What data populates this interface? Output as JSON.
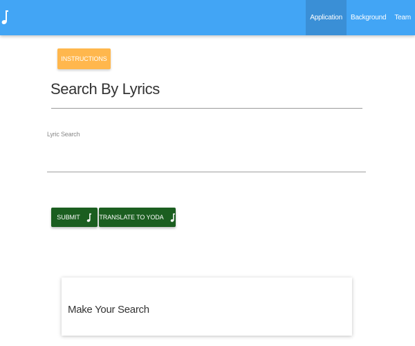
{
  "navbar": {
    "logo_icon": "music-note-icon",
    "links": [
      {
        "label": "Application",
        "active": true
      },
      {
        "label": "Background",
        "active": false
      },
      {
        "label": "Team",
        "active": false
      }
    ],
    "color": "#42a5f5"
  },
  "instructions_button": {
    "label": "INSTRUCTIONS",
    "color": "#ffb74d"
  },
  "page_title": "Search By Lyrics",
  "lyric_search": {
    "label": "Lyric Search",
    "value": "",
    "placeholder": ""
  },
  "buttons": {
    "submit_label": "SUBMIT",
    "translate_label": "TRANSLATE TO YODA",
    "icon": "music-note-icon",
    "color": "#1b5e20"
  },
  "result_card": {
    "text": "Make Your Search"
  }
}
